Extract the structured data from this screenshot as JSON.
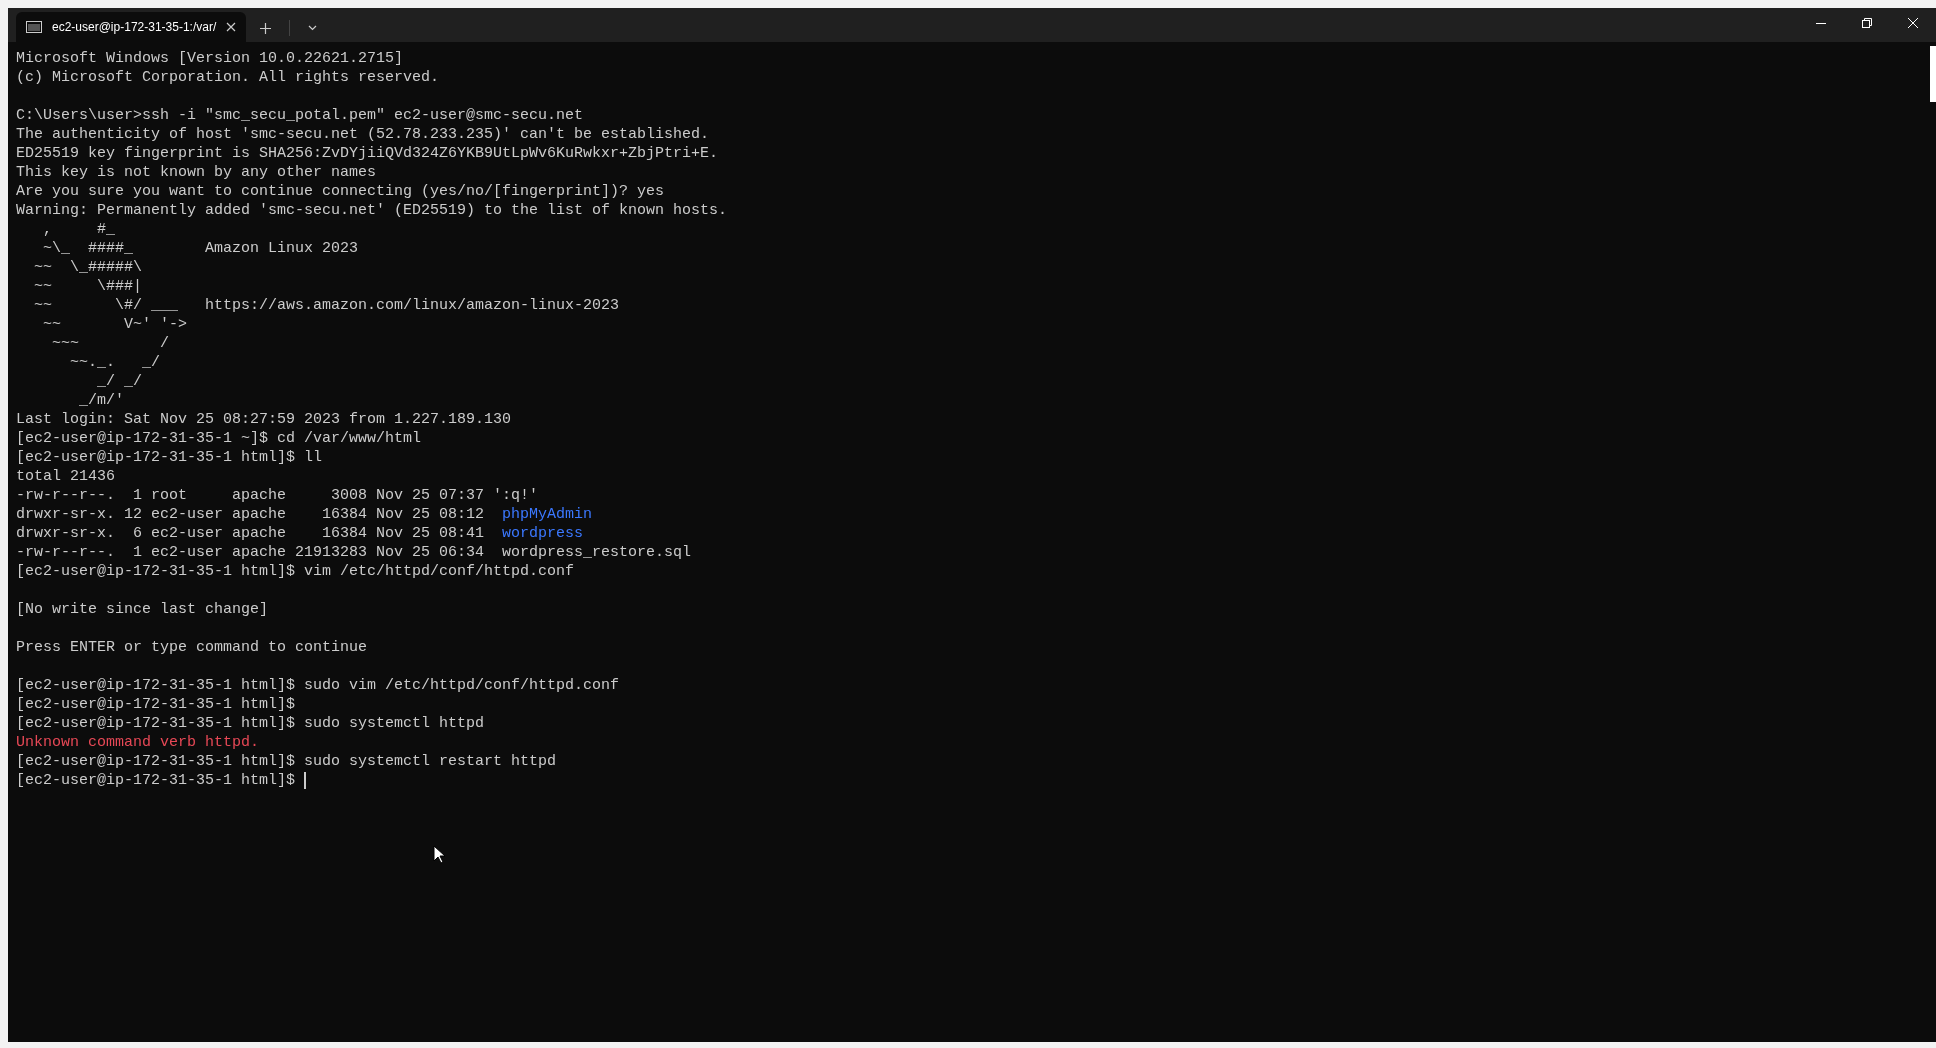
{
  "tab": {
    "title": "ec2-user@ip-172-31-35-1:/var/",
    "selected": true
  },
  "terminal": {
    "blocks": [
      {
        "lines": [
          {
            "segments": [
              {
                "text": "Microsoft Windows [Version 10.0.22621.2715]",
                "kind": "normal"
              }
            ]
          },
          {
            "segments": [
              {
                "text": "(c) Microsoft Corporation. All rights reserved.",
                "kind": "normal"
              }
            ]
          }
        ]
      },
      {
        "lines": [
          {
            "segments": [
              {
                "text": "C:\\Users\\user>ssh -i \"smc_secu_potal.pem\" ec2-user@smc-secu.net",
                "kind": "normal"
              }
            ]
          },
          {
            "segments": [
              {
                "text": "The authenticity of host 'smc-secu.net (52.78.233.235)' can't be established.",
                "kind": "normal"
              }
            ]
          },
          {
            "segments": [
              {
                "text": "ED25519 key fingerprint is SHA256:ZvDYjiiQVd324Z6YKB9UtLpWv6KuRwkxr+ZbjPtri+E.",
                "kind": "normal"
              }
            ]
          },
          {
            "segments": [
              {
                "text": "This key is not known by any other names",
                "kind": "normal"
              }
            ]
          },
          {
            "segments": [
              {
                "text": "Are you sure you want to continue connecting (yes/no/[fingerprint])? yes",
                "kind": "normal"
              }
            ]
          },
          {
            "segments": [
              {
                "text": "Warning: Permanently added 'smc-secu.net' (ED25519) to the list of known hosts.",
                "kind": "normal"
              }
            ]
          },
          {
            "segments": [
              {
                "text": "   ,     #_",
                "kind": "normal"
              }
            ]
          },
          {
            "segments": [
              {
                "text": "   ~\\_  ####_        Amazon Linux 2023",
                "kind": "normal"
              }
            ]
          },
          {
            "segments": [
              {
                "text": "  ~~  \\_#####\\",
                "kind": "normal"
              }
            ]
          },
          {
            "segments": [
              {
                "text": "  ~~     \\###|",
                "kind": "normal"
              }
            ]
          },
          {
            "segments": [
              {
                "text": "  ~~       \\#/ ___   https://aws.amazon.com/linux/amazon-linux-2023",
                "kind": "normal"
              }
            ]
          },
          {
            "segments": [
              {
                "text": "   ~~       V~' '->",
                "kind": "normal"
              }
            ]
          },
          {
            "segments": [
              {
                "text": "    ~~~         /",
                "kind": "normal"
              }
            ]
          },
          {
            "segments": [
              {
                "text": "      ~~._.   _/",
                "kind": "normal"
              }
            ]
          },
          {
            "segments": [
              {
                "text": "         _/ _/",
                "kind": "normal"
              }
            ]
          },
          {
            "segments": [
              {
                "text": "       _/m/'",
                "kind": "normal"
              }
            ]
          },
          {
            "segments": [
              {
                "text": "Last login: Sat Nov 25 08:27:59 2023 from 1.227.189.130",
                "kind": "normal"
              }
            ]
          },
          {
            "segments": [
              {
                "text": "[ec2-user@ip-172-31-35-1 ~]$ cd /var/www/html",
                "kind": "normal"
              }
            ]
          },
          {
            "segments": [
              {
                "text": "[ec2-user@ip-172-31-35-1 html]$ ll",
                "kind": "normal"
              }
            ]
          },
          {
            "segments": [
              {
                "text": "total 21436",
                "kind": "normal"
              }
            ]
          },
          {
            "segments": [
              {
                "text": "-rw-r--r--.  1 root     apache     3008 Nov 25 07:37 ':q!'",
                "kind": "normal"
              }
            ]
          },
          {
            "segments": [
              {
                "text": "drwxr-sr-x. 12 ec2-user apache    16384 Nov 25 08:12  ",
                "kind": "normal"
              },
              {
                "text": "phpMyAdmin",
                "kind": "directory"
              }
            ]
          },
          {
            "segments": [
              {
                "text": "drwxr-sr-x.  6 ec2-user apache    16384 Nov 25 08:41  ",
                "kind": "normal"
              },
              {
                "text": "wordpress",
                "kind": "directory"
              }
            ]
          },
          {
            "segments": [
              {
                "text": "-rw-r--r--.  1 ec2-user apache 21913283 Nov 25 06:34  wordpress_restore.sql",
                "kind": "normal"
              }
            ]
          },
          {
            "segments": [
              {
                "text": "[ec2-user@ip-172-31-35-1 html]$ vim /etc/httpd/conf/httpd.conf",
                "kind": "normal"
              }
            ]
          }
        ]
      },
      {
        "lines": [
          {
            "segments": [
              {
                "text": "[No write since last change]",
                "kind": "normal"
              }
            ]
          }
        ]
      },
      {
        "lines": [
          {
            "segments": [
              {
                "text": "Press ENTER or type command to continue",
                "kind": "normal"
              }
            ]
          }
        ]
      },
      {
        "lines": [
          {
            "segments": [
              {
                "text": "[ec2-user@ip-172-31-35-1 html]$ sudo vim /etc/httpd/conf/httpd.conf",
                "kind": "normal"
              }
            ]
          },
          {
            "segments": [
              {
                "text": "[ec2-user@ip-172-31-35-1 html]$",
                "kind": "normal"
              }
            ]
          },
          {
            "segments": [
              {
                "text": "[ec2-user@ip-172-31-35-1 html]$ sudo systemctl httpd",
                "kind": "normal"
              }
            ]
          },
          {
            "segments": [
              {
                "text": "Unknown command verb httpd.",
                "kind": "error"
              }
            ]
          },
          {
            "segments": [
              {
                "text": "[ec2-user@ip-172-31-35-1 html]$ sudo systemctl restart httpd",
                "kind": "normal"
              }
            ]
          },
          {
            "segments": [
              {
                "text": "[ec2-user@ip-172-31-35-1 html]$ ",
                "kind": "normal"
              }
            ],
            "cursor": true
          }
        ]
      }
    ]
  }
}
